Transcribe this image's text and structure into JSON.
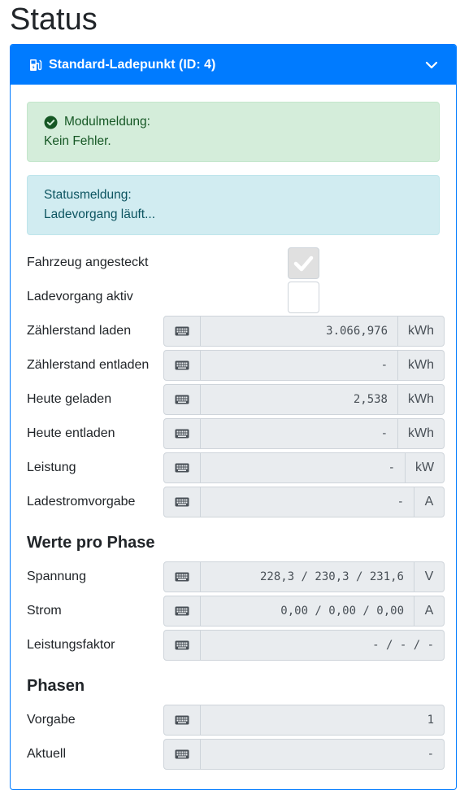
{
  "page_title": "Status",
  "card": {
    "title": "Standard-Ladepunkt (ID: 4)",
    "icon": "charging-station-icon",
    "collapse_icon": "chevron-down-icon",
    "accent": "#007bff"
  },
  "alerts": {
    "module": {
      "title": "Modulmeldung:",
      "text": "Kein Fehler.",
      "color": "#d4edda"
    },
    "status": {
      "title": "Statusmeldung:",
      "text": "Ladevorgang läuft...",
      "color": "#d1ecf1"
    }
  },
  "checks": [
    {
      "label": "Fahrzeug angesteckt",
      "checked": true
    },
    {
      "label": "Ladevorgang aktiv",
      "checked": false
    }
  ],
  "fields": [
    {
      "label": "Zählerstand laden",
      "value": "3.066,976",
      "unit": "kWh"
    },
    {
      "label": "Zählerstand entladen",
      "value": "-",
      "unit": "kWh"
    },
    {
      "label": "Heute geladen",
      "value": "2,538",
      "unit": "kWh"
    },
    {
      "label": "Heute entladen",
      "value": "-",
      "unit": "kWh"
    },
    {
      "label": "Leistung",
      "value": "-",
      "unit": "kW"
    },
    {
      "label": "Ladestromvorgabe",
      "value": "-",
      "unit": "A"
    }
  ],
  "phase_values": {
    "title": "Werte pro Phase",
    "fields": [
      {
        "label": "Spannung",
        "value": "228,3 / 230,3 / 231,6",
        "unit": "V"
      },
      {
        "label": "Strom",
        "value": "0,00 / 0,00 / 0,00",
        "unit": "A"
      },
      {
        "label": "Leistungsfaktor",
        "value": "- / - / -",
        "unit": ""
      }
    ]
  },
  "phases": {
    "title": "Phasen",
    "fields": [
      {
        "label": "Vorgabe",
        "value": "1",
        "unit": ""
      },
      {
        "label": "Aktuell",
        "value": "-",
        "unit": ""
      }
    ]
  }
}
